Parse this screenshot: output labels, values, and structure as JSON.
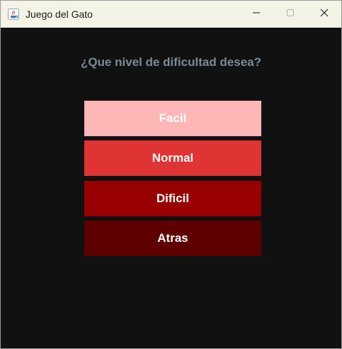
{
  "window": {
    "title": "Juego del Gato",
    "app_icon": "java-icon"
  },
  "controls": {
    "minimize_icon": "minimize-icon",
    "maximize_icon": "maximize-icon",
    "close_icon": "close-icon"
  },
  "main": {
    "prompt": "¿Que nivel de dificultad desea?",
    "buttons": [
      {
        "label": "Facil",
        "color": "#ffb6b6"
      },
      {
        "label": "Normal",
        "color": "#e03333"
      },
      {
        "label": "Dificil",
        "color": "#990000"
      },
      {
        "label": "Atras",
        "color": "#5e0000"
      }
    ]
  },
  "colors": {
    "background": "#111111",
    "titlebar": "#f4f4e6",
    "prompt_text": "#7c8a93",
    "button_text": "#ffffff"
  }
}
